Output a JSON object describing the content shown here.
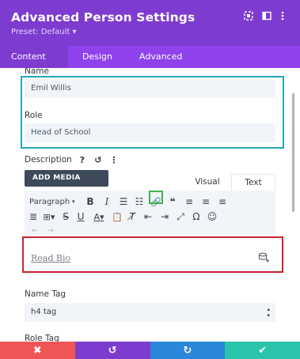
{
  "header": {
    "title": "Advanced Person Settings",
    "preset": "Preset: Default ▾",
    "icons": [
      "focus-icon",
      "sidebar-icon",
      "more-vertical-icon"
    ]
  },
  "tabs": [
    {
      "label": "Content",
      "active": true
    },
    {
      "label": "Design",
      "active": false
    },
    {
      "label": "Advanced",
      "active": false
    }
  ],
  "fields": {
    "name_label": "Name",
    "name_value": "Emil Willis",
    "role_label": "Role",
    "role_value": "Head of School"
  },
  "description": {
    "label": "Description",
    "help_glyph": "?",
    "reset_glyph": "↺",
    "more_glyph": "⋮",
    "add_media": "ADD MEDIA",
    "tab_visual": "Visual",
    "tab_text": "Text",
    "toolbar_paragraph": "Paragraph",
    "editor_link_text": "Read Bio"
  },
  "name_tag": {
    "label": "Name Tag",
    "value": "h4 tag"
  },
  "role_tag": {
    "label": "Role Tag"
  },
  "bottom_bar": {
    "cancel": "✖",
    "undo": "↺",
    "redo": "↻",
    "save": "✔"
  },
  "colors": {
    "header": "#7e3bd0",
    "tabs": "#8f42ec",
    "cancel": "#ef5555",
    "undo": "#7e3bd0",
    "redo": "#2b87da",
    "save": "#29c4a9",
    "highlight_teal": "#22a8b4",
    "highlight_red": "#c9232e",
    "highlight_green": "#44b14b"
  }
}
